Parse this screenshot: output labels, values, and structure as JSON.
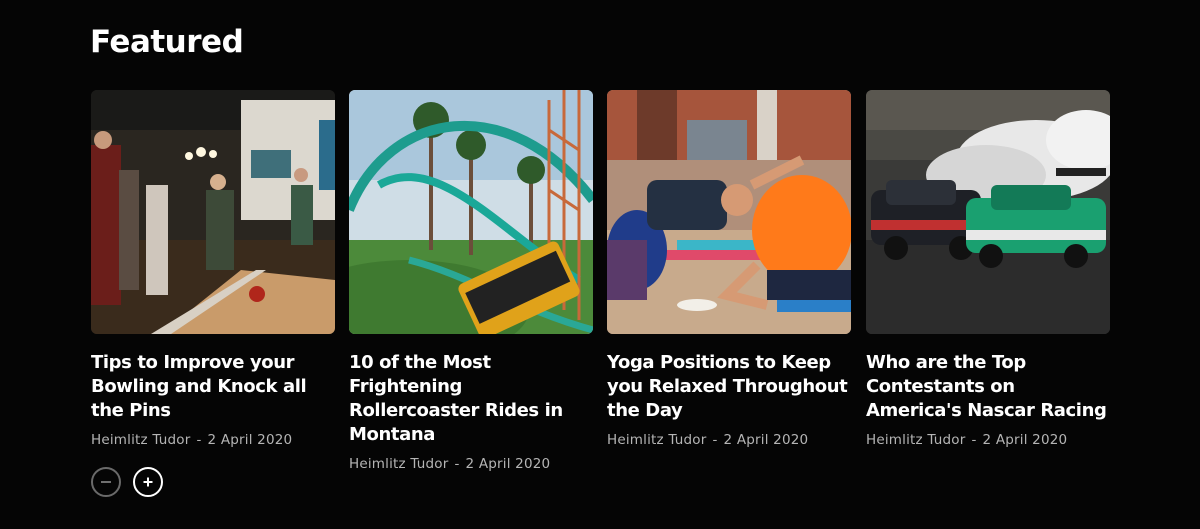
{
  "section": {
    "title": "Featured"
  },
  "posts": [
    {
      "title": "Tips to Improve your Bowling and Knock all the Pins",
      "author": "Heimlitz Tudor",
      "separator": "-",
      "date": "2 April 2020",
      "image_icon": "bowling-photo"
    },
    {
      "title": "10 of the Most Frightening Rollercoaster Rides in Montana",
      "author": "Heimlitz Tudor",
      "separator": "-",
      "date": "2 April 2020",
      "image_icon": "rollercoaster-photo"
    },
    {
      "title": "Yoga Positions to Keep you Relaxed Throughout the Day",
      "author": "Heimlitz Tudor",
      "separator": "-",
      "date": "2 April 2020",
      "image_icon": "yoga-photo"
    },
    {
      "title": "Who are the Top Contestants on America's Nascar Racing",
      "author": "Heimlitz Tudor",
      "separator": "-",
      "date": "2 April 2020",
      "image_icon": "racing-photo"
    }
  ],
  "carousel": {
    "prev_icon": "minus-icon",
    "next_icon": "plus-icon"
  },
  "colors": {
    "background": "#050505",
    "text": "#ffffff",
    "meta": "#b5b5b5",
    "nav_disabled": "#6a6a6a"
  }
}
